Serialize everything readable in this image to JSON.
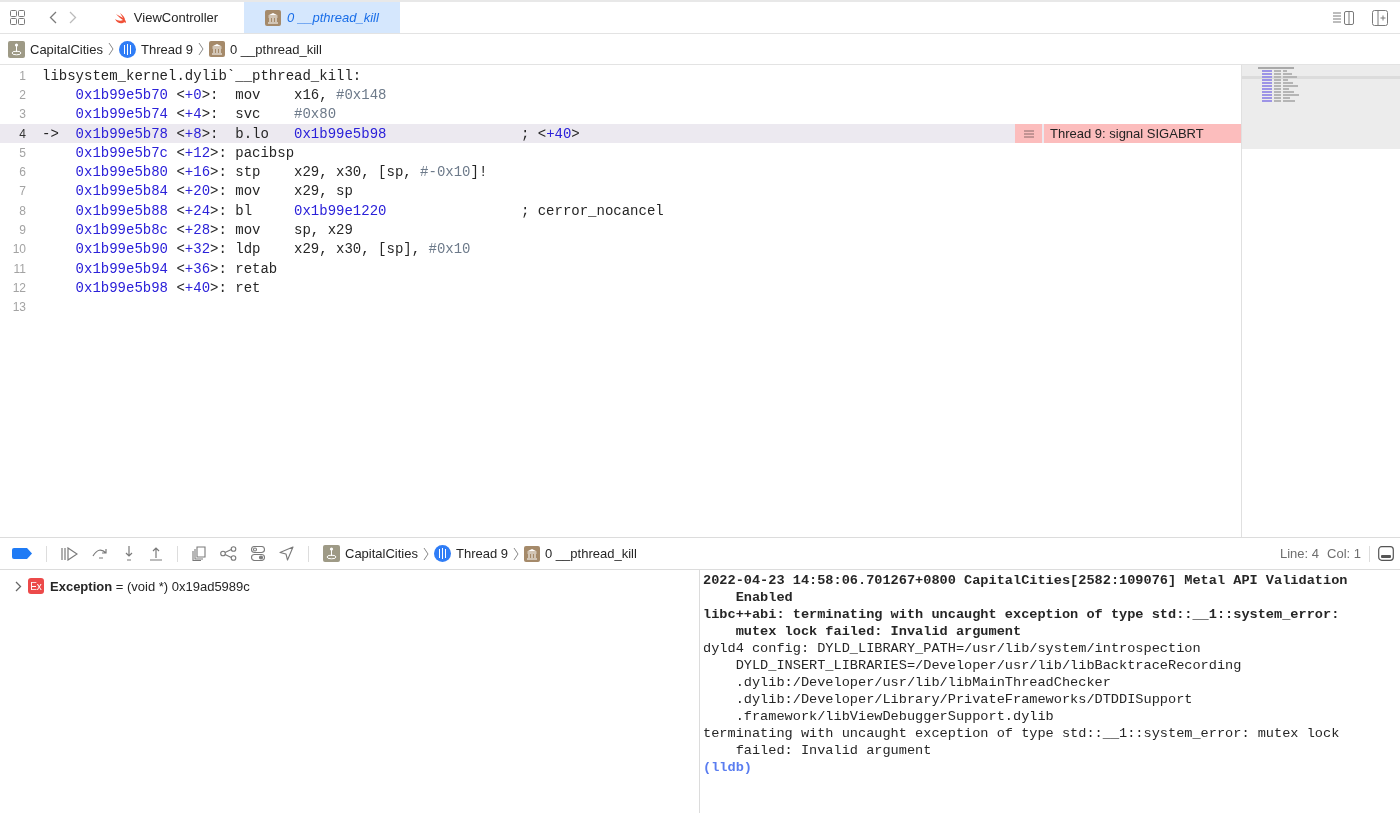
{
  "tabs": [
    {
      "label": "ViewController",
      "selected": false
    },
    {
      "label": "0 __pthread_kill",
      "selected": true
    }
  ],
  "breadcrumb": [
    {
      "label": "CapitalCities"
    },
    {
      "label": "Thread 9"
    },
    {
      "label": "0 __pthread_kill"
    }
  ],
  "editor": {
    "lines": [
      {
        "num": "1",
        "kind": "label",
        "current": false,
        "segments": [
          {
            "text": "libsystem_kernel.dylib`__pthread_kill:",
            "kind": "plain"
          }
        ]
      },
      {
        "num": "2",
        "kind": "instr",
        "current": false,
        "segments": [
          {
            "text": "0x1b99e5b70",
            "kind": "addr"
          },
          {
            "text": " <",
            "kind": "plain"
          },
          {
            "text": "+0",
            "kind": "addr"
          },
          {
            "text": ">:  mov    x16, ",
            "kind": "plain"
          },
          {
            "text": "#0x148",
            "kind": "imm"
          }
        ]
      },
      {
        "num": "3",
        "kind": "instr",
        "current": false,
        "segments": [
          {
            "text": "0x1b99e5b74",
            "kind": "addr"
          },
          {
            "text": " <",
            "kind": "plain"
          },
          {
            "text": "+4",
            "kind": "addr"
          },
          {
            "text": ">:  svc    ",
            "kind": "plain"
          },
          {
            "text": "#0x80",
            "kind": "imm"
          }
        ]
      },
      {
        "num": "4",
        "kind": "instr",
        "current": true,
        "arrow": "->",
        "issue": "Thread 9: signal SIGABRT",
        "segments": [
          {
            "text": "0x1b99e5b78",
            "kind": "addr"
          },
          {
            "text": " <",
            "kind": "plain"
          },
          {
            "text": "+8",
            "kind": "addr"
          },
          {
            "text": ">:  b.lo   ",
            "kind": "plain"
          },
          {
            "text": "0x1b99e5b98",
            "kind": "addr"
          },
          {
            "text": "                ; <",
            "kind": "plain"
          },
          {
            "text": "+40",
            "kind": "addr"
          },
          {
            "text": ">",
            "kind": "plain"
          }
        ]
      },
      {
        "num": "5",
        "kind": "instr",
        "current": false,
        "segments": [
          {
            "text": "0x1b99e5b7c",
            "kind": "addr"
          },
          {
            "text": " <",
            "kind": "plain"
          },
          {
            "text": "+12",
            "kind": "addr"
          },
          {
            "text": ">: pacibsp",
            "kind": "plain"
          }
        ]
      },
      {
        "num": "6",
        "kind": "instr",
        "current": false,
        "segments": [
          {
            "text": "0x1b99e5b80",
            "kind": "addr"
          },
          {
            "text": " <",
            "kind": "plain"
          },
          {
            "text": "+16",
            "kind": "addr"
          },
          {
            "text": ">: stp    x29, x30, [sp, ",
            "kind": "plain"
          },
          {
            "text": "#-0x10",
            "kind": "imm"
          },
          {
            "text": "]!",
            "kind": "plain"
          }
        ]
      },
      {
        "num": "7",
        "kind": "instr",
        "current": false,
        "segments": [
          {
            "text": "0x1b99e5b84",
            "kind": "addr"
          },
          {
            "text": " <",
            "kind": "plain"
          },
          {
            "text": "+20",
            "kind": "addr"
          },
          {
            "text": ">: mov    x29, sp",
            "kind": "plain"
          }
        ]
      },
      {
        "num": "8",
        "kind": "instr",
        "current": false,
        "segments": [
          {
            "text": "0x1b99e5b88",
            "kind": "addr"
          },
          {
            "text": " <",
            "kind": "plain"
          },
          {
            "text": "+24",
            "kind": "addr"
          },
          {
            "text": ">: bl     ",
            "kind": "plain"
          },
          {
            "text": "0x1b99e1220",
            "kind": "addr"
          },
          {
            "text": "                ; cerror_nocancel",
            "kind": "plain"
          }
        ]
      },
      {
        "num": "9",
        "kind": "instr",
        "current": false,
        "segments": [
          {
            "text": "0x1b99e5b8c",
            "kind": "addr"
          },
          {
            "text": " <",
            "kind": "plain"
          },
          {
            "text": "+28",
            "kind": "addr"
          },
          {
            "text": ">: mov    sp, x29",
            "kind": "plain"
          }
        ]
      },
      {
        "num": "10",
        "kind": "instr",
        "current": false,
        "segments": [
          {
            "text": "0x1b99e5b90",
            "kind": "addr"
          },
          {
            "text": " <",
            "kind": "plain"
          },
          {
            "text": "+32",
            "kind": "addr"
          },
          {
            "text": ">: ldp    x29, x30, [sp], ",
            "kind": "plain"
          },
          {
            "text": "#0x10",
            "kind": "imm"
          }
        ]
      },
      {
        "num": "11",
        "kind": "instr",
        "current": false,
        "segments": [
          {
            "text": "0x1b99e5b94",
            "kind": "addr"
          },
          {
            "text": " <",
            "kind": "plain"
          },
          {
            "text": "+36",
            "kind": "addr"
          },
          {
            "text": ">: retab",
            "kind": "plain"
          }
        ]
      },
      {
        "num": "12",
        "kind": "instr",
        "current": false,
        "segments": [
          {
            "text": "0x1b99e5b98",
            "kind": "addr"
          },
          {
            "text": " <",
            "kind": "plain"
          },
          {
            "text": "+40",
            "kind": "addr"
          },
          {
            "text": ">: ret",
            "kind": "plain"
          }
        ]
      },
      {
        "num": "13",
        "kind": "empty",
        "current": false
      }
    ]
  },
  "debug_bar": {
    "breadcrumb": [
      {
        "label": "CapitalCities"
      },
      {
        "label": "Thread 9"
      },
      {
        "label": "0 __pthread_kill"
      }
    ],
    "line": "Line: 4",
    "col": "Col: 1"
  },
  "variables": [
    {
      "badge": "Ex",
      "text": "**Exception** = (void *) 0x19ad5989c",
      "expanded": false
    }
  ],
  "console": {
    "lines": [
      {
        "text": "2022-04-23 14:58:06.701267+0800 CapitalCities[2582:109076] Metal API Validation",
        "kind": "entry",
        "bold": true
      },
      {
        "text": "Enabled",
        "kind": "wrap",
        "bold": true
      },
      {
        "text": "libc++abi: terminating with uncaught exception of type std::__1::system_error:",
        "kind": "entry",
        "bold": true
      },
      {
        "text": "mutex lock failed: Invalid argument",
        "kind": "wrap",
        "bold": true
      },
      {
        "text": "dyld4 config: DYLD_LIBRARY_PATH=/usr/lib/system/introspection",
        "kind": "entry",
        "bold": false
      },
      {
        "text": "DYLD_INSERT_LIBRARIES=/Developer/usr/lib/libBacktraceRecording",
        "kind": "wrap",
        "bold": false
      },
      {
        "text": ".dylib:/Developer/usr/lib/libMainThreadChecker",
        "kind": "wrap",
        "bold": false
      },
      {
        "text": ".dylib:/Developer/Library/PrivateFrameworks/DTDDISupport",
        "kind": "wrap",
        "bold": false
      },
      {
        "text": ".framework/libViewDebuggerSupport.dylib",
        "kind": "wrap",
        "bold": false
      },
      {
        "text": "terminating with uncaught exception of type std::__1::system_error: mutex lock",
        "kind": "entry",
        "bold": false
      },
      {
        "text": "failed: Invalid argument",
        "kind": "wrap",
        "bold": false
      }
    ],
    "prompt": "(lldb)"
  }
}
